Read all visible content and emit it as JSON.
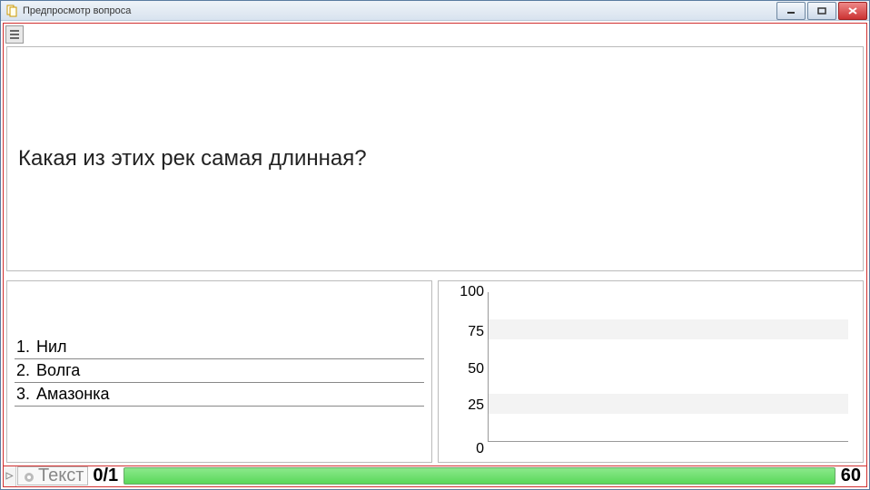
{
  "window": {
    "title": "Предпросмотр вопроса"
  },
  "question": {
    "text": "Какая из этих рек самая длинная?"
  },
  "answers": [
    {
      "n": "1.",
      "label": "Нил"
    },
    {
      "n": "2.",
      "label": "Волга"
    },
    {
      "n": "3.",
      "label": "Амазонка"
    }
  ],
  "status": {
    "text_label": "Текст",
    "counter": "0/1",
    "timer": "60"
  },
  "chart_data": {
    "type": "bar",
    "categories": [],
    "values": [],
    "title": "",
    "xlabel": "",
    "ylabel": "",
    "ylim": [
      0,
      100
    ],
    "yticks": [
      0,
      25,
      50,
      75,
      100
    ]
  }
}
